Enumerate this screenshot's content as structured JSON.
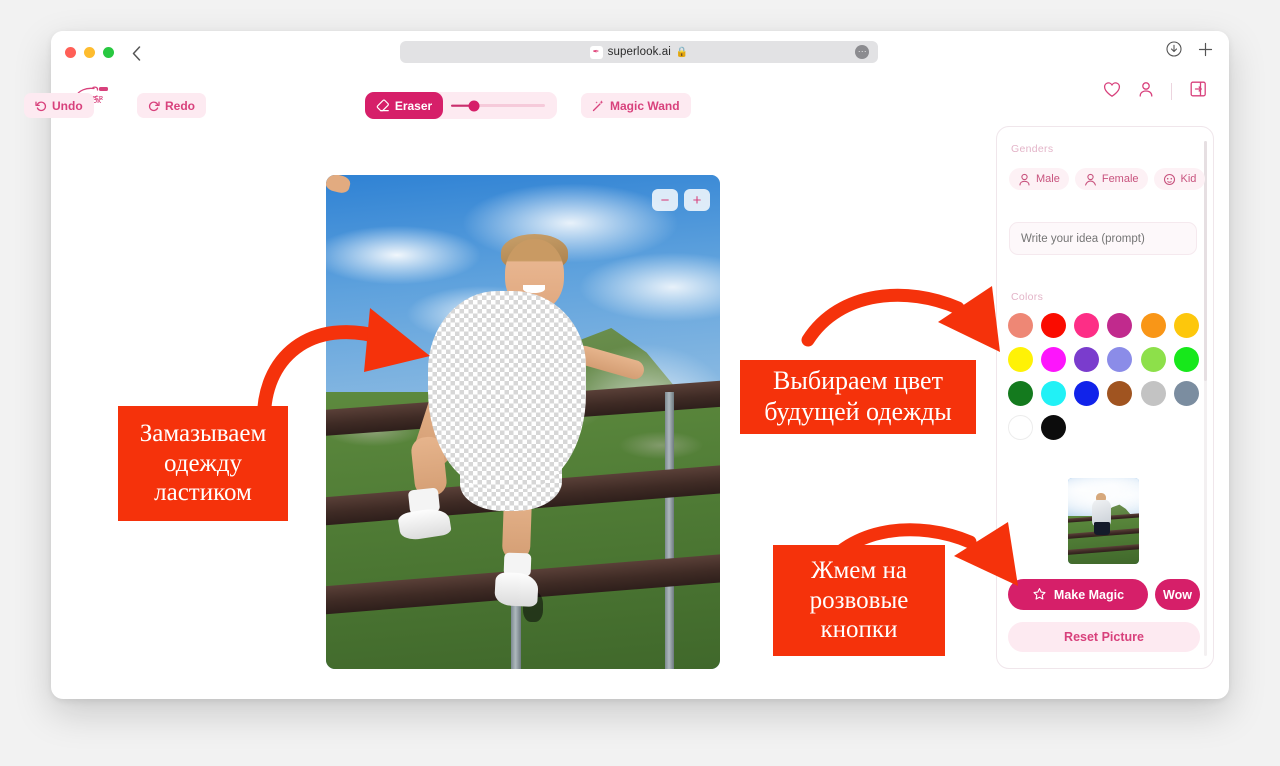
{
  "browser": {
    "url_text": "superlook.ai",
    "favicon_glyph": "✒",
    "lock_glyph": "🔒",
    "menu_glyph": "⋯",
    "back_glyph": "‹",
    "download_icon": "download-icon",
    "newtab_glyph": "+"
  },
  "app_header": {
    "logo_line1": "SUPER",
    "logo_line2": "LOOK",
    "icons": [
      "heart-icon",
      "user-icon",
      "logout-icon"
    ]
  },
  "toolbar": {
    "undo_label": "Undo",
    "redo_label": "Redo",
    "eraser_label": "Eraser",
    "magic_wand_label": "Magic Wand",
    "brush_size_percent": 24
  },
  "canvas": {
    "zoom_out_label": "−",
    "zoom_in_label": "+"
  },
  "panel": {
    "genders_label": "Genders",
    "genders": [
      {
        "label": "Male",
        "icon": "male-avatar-icon"
      },
      {
        "label": "Female",
        "icon": "female-avatar-icon"
      },
      {
        "label": "Kid",
        "icon": "kid-avatar-icon"
      }
    ],
    "prompt_placeholder": "Write your idea (prompt)",
    "prompt_value": "",
    "colors_label": "Colors",
    "colors": [
      "#ee8775",
      "#fa0c00",
      "#fd2e86",
      "#c12a8d",
      "#f99617",
      "#fdc70c",
      "#fff206",
      "#fd15fc",
      "#7a3ccd",
      "#8b8ce8",
      "#8de04a",
      "#17e81b",
      "#147a1e",
      "#21f1f6",
      "#1123ea",
      "#a05420",
      "#c3c3c3",
      "#7b8da0",
      "#ffffff",
      "#0c0c0c"
    ],
    "make_magic_label": "Make Magic",
    "wow_label": "Wow",
    "reset_label": "Reset Picture"
  },
  "annotations": [
    {
      "lines": [
        "Замазываем",
        "одежду",
        "ластиком"
      ]
    },
    {
      "lines": [
        "Выбираем цвет",
        "будущей одежды"
      ]
    },
    {
      "lines": [
        "Жмем на",
        "розвовые",
        "кнопки"
      ]
    }
  ],
  "annotation_color": "#f5320b"
}
